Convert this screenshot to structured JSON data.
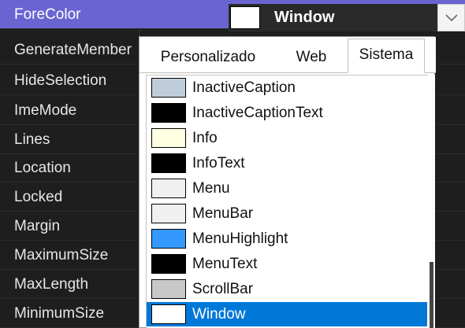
{
  "properties": [
    {
      "name": "ForeColor"
    },
    {
      "name": "GenerateMember"
    },
    {
      "name": "HideSelection"
    },
    {
      "name": "ImeMode"
    },
    {
      "name": "Lines"
    },
    {
      "name": "Location"
    },
    {
      "name": "Locked"
    },
    {
      "name": "Margin"
    },
    {
      "name": "MaximumSize"
    },
    {
      "name": "MaxLength"
    },
    {
      "name": "MinimumSize"
    }
  ],
  "value_editor": {
    "text": "Window",
    "swatch_color": "#ffffff",
    "dropdown_icon": "chevron-down-icon"
  },
  "picker": {
    "tabs": [
      {
        "label": "Personalizado"
      },
      {
        "label": "Web"
      },
      {
        "label": "Sistema"
      }
    ],
    "active_tab": "Sistema",
    "colors": [
      {
        "label": "InactiveCaption",
        "color": "#bfcddb"
      },
      {
        "label": "InactiveCaptionText",
        "color": "#000000"
      },
      {
        "label": "Info",
        "color": "#ffffe1"
      },
      {
        "label": "InfoText",
        "color": "#000000"
      },
      {
        "label": "Menu",
        "color": "#f0f0f0"
      },
      {
        "label": "MenuBar",
        "color": "#f0f0f0"
      },
      {
        "label": "MenuHighlight",
        "color": "#3399ff"
      },
      {
        "label": "MenuText",
        "color": "#000000"
      },
      {
        "label": "ScrollBar",
        "color": "#c8c8c8"
      },
      {
        "label": "Window",
        "color": "#ffffff"
      }
    ],
    "selected_color": "Window"
  },
  "colors": {
    "selected_row": "#6a64d2",
    "selection_highlight": "#0078d7",
    "grid_background": "#1e1e1e"
  }
}
